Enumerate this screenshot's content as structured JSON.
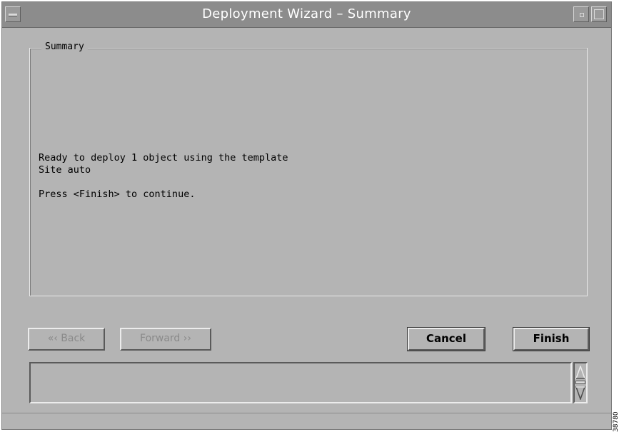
{
  "window": {
    "title": "Deployment Wizard – Summary"
  },
  "summary": {
    "group_label": "Summary",
    "text": "Ready to deploy 1 object using the template\nSite auto\n\nPress <Finish> to continue."
  },
  "buttons": {
    "back": "«‹ Back",
    "forward": "Forward ››",
    "cancel": "Cancel",
    "finish": "Finish"
  },
  "figure_code": "38780"
}
